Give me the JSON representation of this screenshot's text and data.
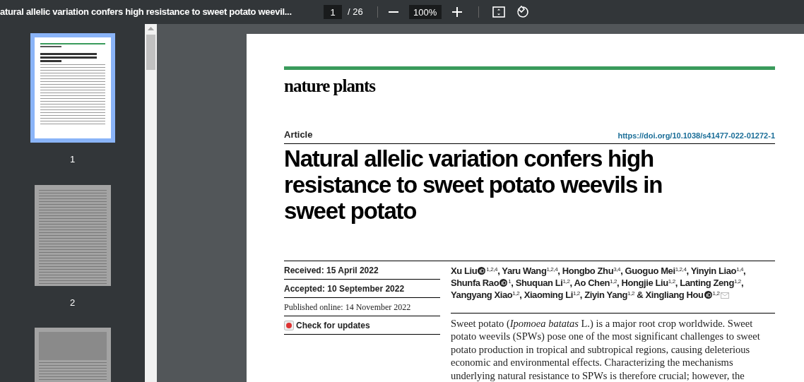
{
  "toolbar": {
    "title": "atural allelic variation confers high resistance to sweet potato weevil...",
    "page_input": "1",
    "page_total": "/ 26",
    "zoom": "100%"
  },
  "thumbnails": [
    {
      "label": "1",
      "selected": true,
      "kind": "title"
    },
    {
      "label": "2",
      "selected": false,
      "kind": "text"
    },
    {
      "selected": false,
      "kind": "figure"
    }
  ],
  "page": {
    "journal": "nature plants",
    "section": "Article",
    "doi": "https://doi.org/10.1038/s41477-022-01272-1",
    "title": "Natural allelic variation confers high resistance to sweet potato weevils in sweet potato",
    "dates": [
      {
        "text": "Received: 15 April 2022",
        "kind": "sans"
      },
      {
        "text": "Accepted: 10 September 2022",
        "kind": "sans"
      },
      {
        "text": "Published online: 14 November 2022",
        "kind": "serif"
      }
    ],
    "check_updates": "Check for updates",
    "authors": [
      {
        "name": "Xu Liu",
        "orcid": true,
        "affil": "1,2,4",
        "sep": ","
      },
      {
        "name": "Yaru Wang",
        "orcid": false,
        "affil": "1,2,4",
        "sep": ","
      },
      {
        "name": "Hongbo Zhu",
        "orcid": false,
        "affil": "3,4",
        "sep": ","
      },
      {
        "name": "Guoguo Mei",
        "orcid": false,
        "affil": "1,2,4",
        "sep": ","
      },
      {
        "name": "Yinyin Liao",
        "orcid": false,
        "affil": "1,4",
        "sep": ","
      },
      {
        "name": "Shunfa Rao",
        "orcid": true,
        "affil": "1",
        "sep": ","
      },
      {
        "name": "Shuquan Li",
        "orcid": false,
        "affil": "1,2",
        "sep": ","
      },
      {
        "name": "Ao Chen",
        "orcid": false,
        "affil": "1,2",
        "sep": ","
      },
      {
        "name": "Hongjie Liu",
        "orcid": false,
        "affil": "1,2",
        "sep": ","
      },
      {
        "name": "Lanting Zeng",
        "orcid": false,
        "affil": "1,2",
        "sep": ","
      },
      {
        "name": "Yangyang Xiao",
        "orcid": false,
        "affil": "1,2",
        "sep": ","
      },
      {
        "name": "Xiaoming Li",
        "orcid": false,
        "affil": "1,2",
        "sep": ","
      },
      {
        "name": "Ziyin Yang",
        "orcid": false,
        "affil": "1,2",
        "sep": " &"
      },
      {
        "name": "Xingliang Hou",
        "orcid": true,
        "affil": "1,2",
        "mail": true
      }
    ],
    "abstract": "Sweet potato (*Ipomoea batatas* L.) is a major root crop worldwide. Sweet potato weevils (SPWs) pose one of the most significant challenges to sweet potato production in tropical and subtropical regions, causing deleterious economic and environmental effects. Characterizing the mechanisms underlying natural resistance to SPWs is therefore crucial; however, the"
  }
}
